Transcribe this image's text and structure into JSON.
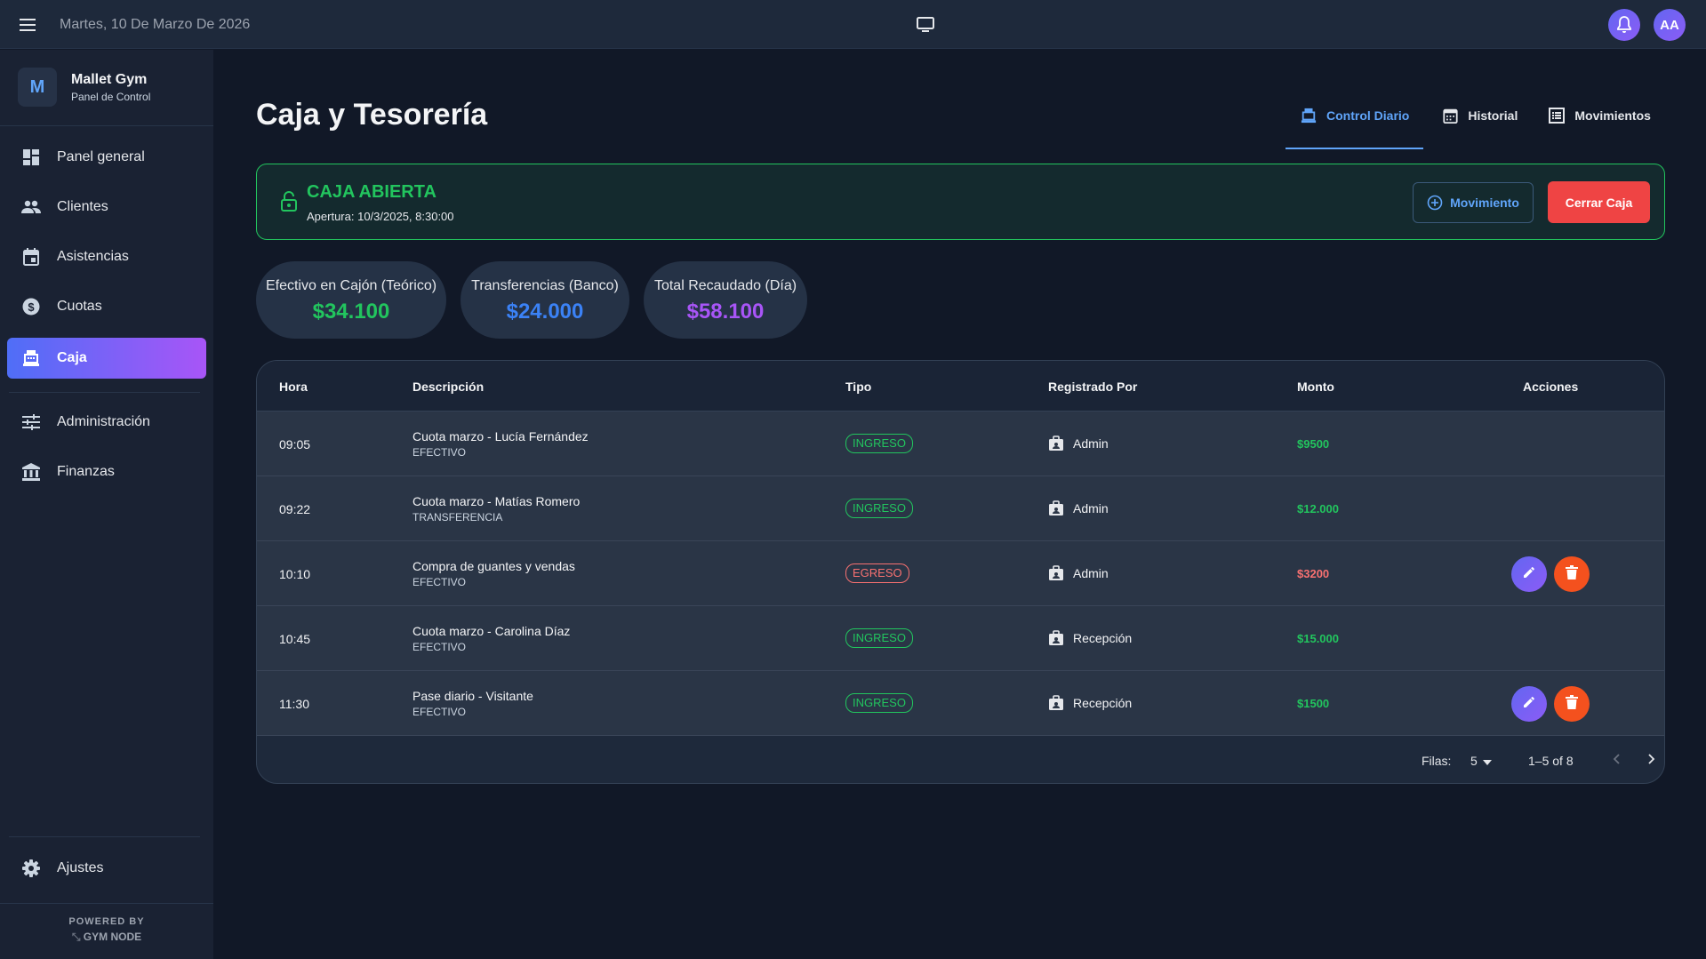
{
  "topbar": {
    "date": "Martes, 10 De Marzo De 2026",
    "avatar_initials": "AA"
  },
  "brand": {
    "initial": "M",
    "name": "Mallet Gym",
    "subtitle": "Panel de Control"
  },
  "sidebar": {
    "items": [
      {
        "label": "Panel general",
        "icon": "dashboard-icon"
      },
      {
        "label": "Clientes",
        "icon": "people-icon"
      },
      {
        "label": "Asistencias",
        "icon": "calendar-icon"
      },
      {
        "label": "Cuotas",
        "icon": "dollar-icon"
      },
      {
        "label": "Caja",
        "icon": "cash-register-icon",
        "active": true
      },
      {
        "label": "Administración",
        "icon": "sliders-icon"
      },
      {
        "label": "Finanzas",
        "icon": "bank-icon"
      }
    ],
    "settings_label": "Ajustes",
    "powered_by": "POWERED BY",
    "powered_brand": "GYM NODE"
  },
  "main": {
    "title": "Caja y Tesorería",
    "tabs": [
      {
        "label": "Control Diario",
        "active": true
      },
      {
        "label": "Historial"
      },
      {
        "label": "Movimientos"
      }
    ]
  },
  "status": {
    "title": "CAJA ABIERTA",
    "subtitle": "Apertura: 10/3/2025, 8:30:00",
    "movement_button": "Movimiento",
    "close_button": "Cerrar Caja"
  },
  "stats": [
    {
      "label": "Efectivo en Cajón (Teórico)",
      "value": "$34.100",
      "color": "#22c55e"
    },
    {
      "label": "Transferencias (Banco)",
      "value": "$24.000",
      "color": "#3b82f6"
    },
    {
      "label": "Total Recaudado (Día)",
      "value": "$58.100",
      "color": "#a855f7"
    }
  ],
  "table": {
    "headers": [
      "Hora",
      "Descripción",
      "Tipo",
      "Registrado Por",
      "Monto",
      "Acciones"
    ],
    "rows": [
      {
        "hora": "09:05",
        "desc": "Cuota marzo - Lucía Fernández",
        "metodo": "EFECTIVO",
        "tipo": "INGRESO",
        "registrado": "Admin",
        "monto": "$9500",
        "actions": false
      },
      {
        "hora": "09:22",
        "desc": "Cuota marzo - Matías Romero",
        "metodo": "TRANSFERENCIA",
        "tipo": "INGRESO",
        "registrado": "Admin",
        "monto": "$12.000",
        "actions": false
      },
      {
        "hora": "10:10",
        "desc": "Compra de guantes y vendas",
        "metodo": "EFECTIVO",
        "tipo": "EGRESO",
        "registrado": "Admin",
        "monto": "$3200",
        "actions": true
      },
      {
        "hora": "10:45",
        "desc": "Cuota marzo - Carolina Díaz",
        "metodo": "EFECTIVO",
        "tipo": "INGRESO",
        "registrado": "Recepción",
        "monto": "$15.000",
        "actions": false
      },
      {
        "hora": "11:30",
        "desc": "Pase diario - Visitante",
        "metodo": "EFECTIVO",
        "tipo": "INGRESO",
        "registrado": "Recepción",
        "monto": "$1500",
        "actions": true
      }
    ],
    "colors": {
      "ingreso": "#22c55e",
      "egreso": "#f87171"
    }
  },
  "pagination": {
    "rows_label": "Filas:",
    "rows_per_page": "5",
    "range": "1–5 of 8"
  }
}
